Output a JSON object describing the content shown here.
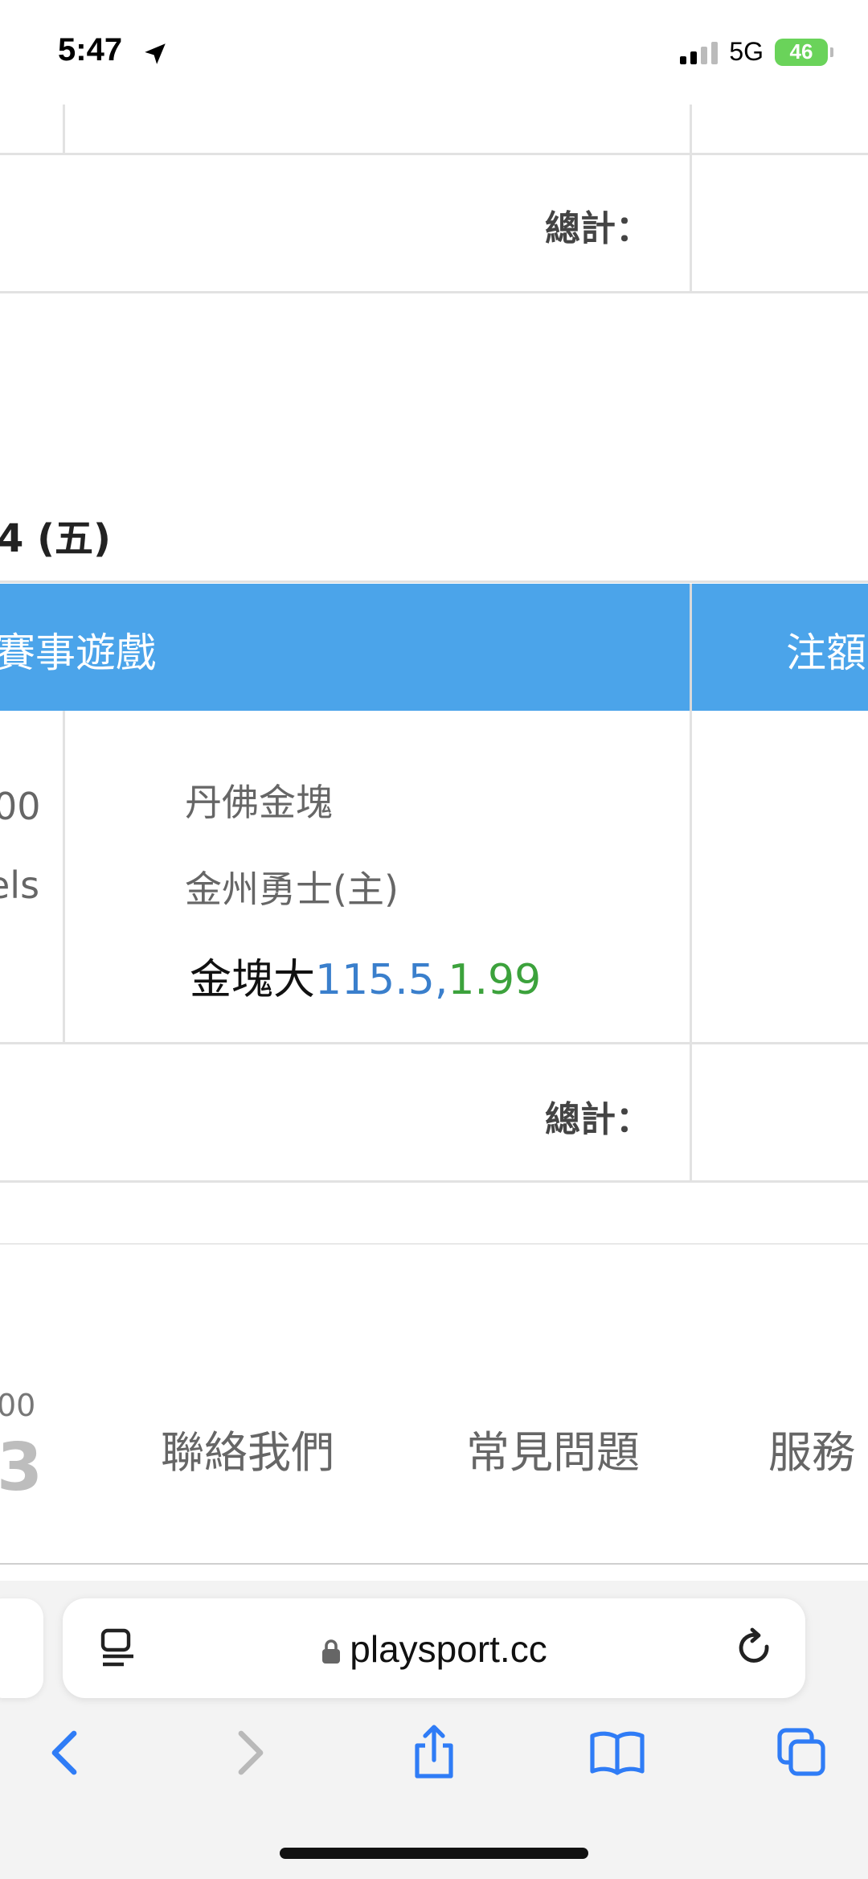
{
  "status_bar": {
    "time": "5:47",
    "network": "5G",
    "battery": "46"
  },
  "section1": {
    "total_label": "總計："
  },
  "section2": {
    "date_title": "4 (五)",
    "header": {
      "col_game": "賽事遊戲",
      "col_amount": "注額"
    },
    "row": {
      "left_line1": "00",
      "left_line2": "els",
      "team_away": "丹佛金塊",
      "team_home": "金州勇士(主)",
      "bet_pick": "金塊大",
      "bet_line": "115.5,",
      "bet_odds": "1.99"
    },
    "total_label": "總計："
  },
  "footer": {
    "left_small": "00",
    "left_big": "3",
    "links": [
      "聯絡我們",
      "常見問題",
      "服務"
    ]
  },
  "browser": {
    "url": "playsport.cc"
  },
  "colors": {
    "header_blue": "#4ba4ea",
    "line_blue": "#3a7fcc",
    "odds_green": "#3ca23c",
    "ios_blue": "#2f7cf6"
  }
}
